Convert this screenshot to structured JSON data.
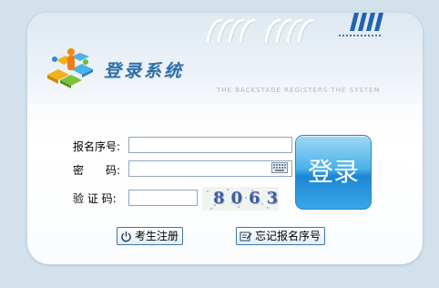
{
  "header": {
    "title": "登录系统",
    "subtitle": "THE BACKSTAGE REGISTERS THE SYSTEM"
  },
  "form": {
    "reg_number_label": "报名序号:",
    "password_label": "密　　码:",
    "captcha_label": "验 证 码:",
    "reg_number_value": "",
    "password_value": "",
    "captcha_value": "",
    "captcha_text": "8063"
  },
  "buttons": {
    "login": "登录",
    "register": "考生注册",
    "forgot": "忘记报名序号"
  },
  "icons": {
    "logo": "people-logo-icon",
    "keyboard": "keyboard-icon",
    "register": "power-icon",
    "forgot": "note-icon"
  },
  "colors": {
    "background": "#d3e1ec",
    "accent": "#2f6fa6",
    "login_button": "#39a6e6"
  }
}
